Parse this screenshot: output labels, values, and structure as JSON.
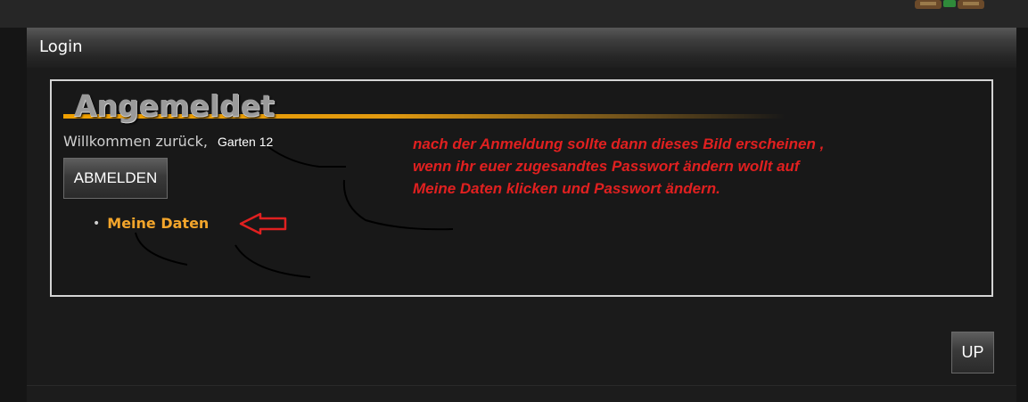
{
  "panel": {
    "title": "Login"
  },
  "login_box": {
    "heading": "Angemeldet",
    "welcome_text": "Willkommen zurück,",
    "username": "Garten 12",
    "logout_label": "ABMELDEN",
    "links": [
      {
        "label": "Meine Daten"
      }
    ]
  },
  "annotation": {
    "lines": [
      "nach der Anmeldung sollte dann dieses Bild erscheinen ,",
      "wenn ihr euer zugesandtes Passwort ändern wollt  auf",
      "Meine Daten klicken und Passwort ändern."
    ],
    "color": "#e02020"
  },
  "footer": {
    "up_label": "UP"
  },
  "colors": {
    "accent": "#f3a52b",
    "heading_underline": "#f0a000",
    "background": "#1b1b1b"
  }
}
